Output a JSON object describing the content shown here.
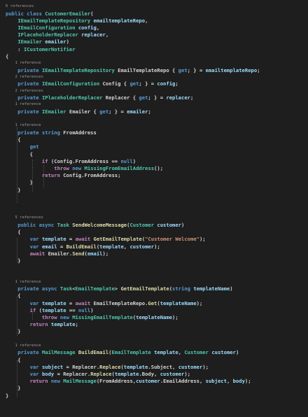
{
  "editor": {
    "theme": {
      "background": "#1e1e1e",
      "keyword": "#569cd6",
      "control": "#c586c0",
      "type": "#4ec9b0",
      "method": "#dcdcaa",
      "variable": "#9cdcfe",
      "string": "#ce9178",
      "text": "#d4d4d4",
      "lens": "#9a9a9a"
    },
    "lines": [
      {
        "kind": "lens",
        "text": "6 references"
      },
      {
        "kind": "code",
        "tokens": [
          [
            "kw",
            "public class "
          ],
          [
            "ty",
            "CustomerEmailer"
          ],
          [
            "pu",
            "("
          ]
        ]
      },
      {
        "kind": "code",
        "tokens": [
          [
            "pu",
            "    "
          ],
          [
            "ty",
            "IEmailTemplateRepository"
          ],
          [
            "pu",
            " "
          ],
          [
            "vr",
            "emailtemplateRepo"
          ],
          [
            "pu",
            ","
          ]
        ]
      },
      {
        "kind": "code",
        "tokens": [
          [
            "pu",
            "    "
          ],
          [
            "ty",
            "IEmailConfiguration"
          ],
          [
            "pu",
            " "
          ],
          [
            "vr",
            "config"
          ],
          [
            "pu",
            ","
          ]
        ]
      },
      {
        "kind": "code",
        "tokens": [
          [
            "pu",
            "    "
          ],
          [
            "ty",
            "IPlaceholderReplacer"
          ],
          [
            "pu",
            " "
          ],
          [
            "vr",
            "replacer"
          ],
          [
            "pu",
            ","
          ]
        ]
      },
      {
        "kind": "code",
        "tokens": [
          [
            "pu",
            "    "
          ],
          [
            "ty",
            "IEmailer"
          ],
          [
            "pu",
            " "
          ],
          [
            "vr",
            "emailer"
          ],
          [
            "pu",
            ")"
          ]
        ]
      },
      {
        "kind": "code",
        "tokens": [
          [
            "pu",
            "    : "
          ],
          [
            "ty",
            "ICustomerNotifier"
          ]
        ]
      },
      {
        "kind": "code",
        "tokens": [
          [
            "pu",
            "{"
          ]
        ]
      },
      {
        "kind": "lens",
        "text": "    1 reference"
      },
      {
        "kind": "code",
        "tokens": [
          [
            "kw",
            "    private "
          ],
          [
            "ty",
            "IEmailTemplateRepository"
          ],
          [
            "pu",
            " EmailTemplateRepo { "
          ],
          [
            "kw",
            "get"
          ],
          [
            "pu",
            "; } = "
          ],
          [
            "vr",
            "emailtemplateRepo"
          ],
          [
            "pu",
            ";"
          ]
        ]
      },
      {
        "kind": "lens",
        "text": "    2 references"
      },
      {
        "kind": "code",
        "tokens": [
          [
            "kw",
            "    private "
          ],
          [
            "ty",
            "IEmailConfiguration"
          ],
          [
            "pu",
            " Config { "
          ],
          [
            "kw",
            "get"
          ],
          [
            "pu",
            "; } = "
          ],
          [
            "vr",
            "config"
          ],
          [
            "pu",
            ";"
          ]
        ]
      },
      {
        "kind": "lens",
        "text": "    2 references"
      },
      {
        "kind": "code",
        "tokens": [
          [
            "kw",
            "    private "
          ],
          [
            "ty",
            "IPlaceholderReplacer"
          ],
          [
            "pu",
            " Replacer { "
          ],
          [
            "kw",
            "get"
          ],
          [
            "pu",
            "; } = "
          ],
          [
            "vr",
            "replacer"
          ],
          [
            "pu",
            ";"
          ]
        ]
      },
      {
        "kind": "lens",
        "text": "    1 reference"
      },
      {
        "kind": "code",
        "tokens": [
          [
            "kw",
            "    private "
          ],
          [
            "ty",
            "IEmailer"
          ],
          [
            "pu",
            " Emailer { "
          ],
          [
            "kw",
            "get"
          ],
          [
            "pu",
            "; } = "
          ],
          [
            "vr",
            "emailer"
          ],
          [
            "pu",
            ";"
          ]
        ]
      },
      {
        "kind": "blank"
      },
      {
        "kind": "lens",
        "text": "    1 reference"
      },
      {
        "kind": "code",
        "tokens": [
          [
            "kw",
            "    private string "
          ],
          [
            "pu",
            "FromAddress"
          ]
        ]
      },
      {
        "kind": "code",
        "tokens": [
          [
            "pu",
            "    {"
          ]
        ]
      },
      {
        "kind": "code",
        "tokens": [
          [
            "kw",
            "        get"
          ]
        ]
      },
      {
        "kind": "code",
        "tokens": [
          [
            "pu",
            "        {"
          ]
        ]
      },
      {
        "kind": "code",
        "tokens": [
          [
            "ctl",
            "            if "
          ],
          [
            "pu",
            "(Config.FromAddress == "
          ],
          [
            "kw",
            "null"
          ],
          [
            "pu",
            ")"
          ]
        ]
      },
      {
        "kind": "code",
        "tokens": [
          [
            "ctl",
            "                throw "
          ],
          [
            "kw",
            "new "
          ],
          [
            "ty",
            "MissingFromEmailAddress"
          ],
          [
            "pu",
            "();"
          ]
        ]
      },
      {
        "kind": "code",
        "tokens": [
          [
            "ctl",
            "            return "
          ],
          [
            "pu",
            "Config.FromAddress;"
          ]
        ]
      },
      {
        "kind": "code",
        "tokens": [
          [
            "pu",
            "        }"
          ]
        ]
      },
      {
        "kind": "code",
        "tokens": [
          [
            "pu",
            "    }"
          ]
        ]
      },
      {
        "kind": "blank"
      },
      {
        "kind": "blank"
      },
      {
        "kind": "blank"
      },
      {
        "kind": "lens",
        "text": "    5 references"
      },
      {
        "kind": "code",
        "tokens": [
          [
            "kw",
            "    public async "
          ],
          [
            "ty",
            "Task"
          ],
          [
            "pu",
            " "
          ],
          [
            "fn",
            "SendWelcomeMessage"
          ],
          [
            "pu",
            "("
          ],
          [
            "ty",
            "Customer"
          ],
          [
            "pu",
            " "
          ],
          [
            "vr",
            "customer"
          ],
          [
            "pu",
            ")"
          ]
        ]
      },
      {
        "kind": "code",
        "tokens": [
          [
            "pu",
            "    {"
          ]
        ]
      },
      {
        "kind": "code",
        "tokens": [
          [
            "kw",
            "        var "
          ],
          [
            "vr",
            "template"
          ],
          [
            "pu",
            " = "
          ],
          [
            "ctl",
            "await "
          ],
          [
            "fn",
            "GetEmailTemplate"
          ],
          [
            "pu",
            "("
          ],
          [
            "st",
            "\"Customer Welcome\""
          ],
          [
            "pu",
            ");"
          ]
        ]
      },
      {
        "kind": "code",
        "tokens": [
          [
            "kw",
            "        var "
          ],
          [
            "vr",
            "email"
          ],
          [
            "pu",
            " = "
          ],
          [
            "fn",
            "BuildEmail"
          ],
          [
            "pu",
            "("
          ],
          [
            "vr",
            "template"
          ],
          [
            "pu",
            ", "
          ],
          [
            "vr",
            "customer"
          ],
          [
            "pu",
            ");"
          ]
        ]
      },
      {
        "kind": "code",
        "tokens": [
          [
            "ctl",
            "        await "
          ],
          [
            "pu",
            "Emailer."
          ],
          [
            "fn",
            "Send"
          ],
          [
            "pu",
            "("
          ],
          [
            "vr",
            "email"
          ],
          [
            "pu",
            ");"
          ]
        ]
      },
      {
        "kind": "code",
        "tokens": [
          [
            "pu",
            "    }"
          ]
        ]
      },
      {
        "kind": "blank"
      },
      {
        "kind": "blank"
      },
      {
        "kind": "lens",
        "text": "    1 reference"
      },
      {
        "kind": "code",
        "tokens": [
          [
            "kw",
            "    private async "
          ],
          [
            "ty",
            "Task"
          ],
          [
            "pu",
            "<"
          ],
          [
            "ty",
            "EmailTemplate"
          ],
          [
            "pu",
            "> "
          ],
          [
            "fn",
            "GetEmailTemplate"
          ],
          [
            "pu",
            "("
          ],
          [
            "kw",
            "string "
          ],
          [
            "vr",
            "templateName"
          ],
          [
            "pu",
            ")"
          ]
        ]
      },
      {
        "kind": "code",
        "tokens": [
          [
            "pu",
            "    {"
          ]
        ]
      },
      {
        "kind": "code",
        "tokens": [
          [
            "kw",
            "        var "
          ],
          [
            "vr",
            "template"
          ],
          [
            "pu",
            " = "
          ],
          [
            "ctl",
            "await "
          ],
          [
            "pu",
            "EmailTemplateRepo."
          ],
          [
            "fn",
            "Get"
          ],
          [
            "pu",
            "("
          ],
          [
            "vr",
            "templateName"
          ],
          [
            "pu",
            ");"
          ]
        ]
      },
      {
        "kind": "code",
        "tokens": [
          [
            "ctl",
            "        if "
          ],
          [
            "pu",
            "("
          ],
          [
            "vr",
            "template"
          ],
          [
            "pu",
            " == "
          ],
          [
            "kw",
            "null"
          ],
          [
            "pu",
            ")"
          ]
        ]
      },
      {
        "kind": "code",
        "tokens": [
          [
            "ctl",
            "            throw "
          ],
          [
            "kw",
            "new "
          ],
          [
            "ty",
            "MissingEmailTemplate"
          ],
          [
            "pu",
            "("
          ],
          [
            "vr",
            "templateName"
          ],
          [
            "pu",
            ");"
          ]
        ]
      },
      {
        "kind": "code",
        "tokens": [
          [
            "ctl",
            "        return "
          ],
          [
            "vr",
            "template"
          ],
          [
            "pu",
            ";"
          ]
        ]
      },
      {
        "kind": "code",
        "tokens": [
          [
            "pu",
            "    }"
          ]
        ]
      },
      {
        "kind": "blank"
      },
      {
        "kind": "lens",
        "text": "    1 reference"
      },
      {
        "kind": "code",
        "tokens": [
          [
            "kw",
            "    private "
          ],
          [
            "ty",
            "MailMessage"
          ],
          [
            "pu",
            " "
          ],
          [
            "fn",
            "BuildEmail"
          ],
          [
            "pu",
            "("
          ],
          [
            "ty",
            "EmailTemplate"
          ],
          [
            "pu",
            " "
          ],
          [
            "vr",
            "template"
          ],
          [
            "pu",
            ", "
          ],
          [
            "ty",
            "Customer"
          ],
          [
            "pu",
            " "
          ],
          [
            "vr",
            "customer"
          ],
          [
            "pu",
            ")"
          ]
        ]
      },
      {
        "kind": "code",
        "tokens": [
          [
            "pu",
            "    {"
          ]
        ]
      },
      {
        "kind": "code",
        "tokens": [
          [
            "kw",
            "        var "
          ],
          [
            "vr",
            "subject"
          ],
          [
            "pu",
            " = Replacer."
          ],
          [
            "fn",
            "Replace"
          ],
          [
            "pu",
            "("
          ],
          [
            "vr",
            "template"
          ],
          [
            "pu",
            ".Subject, "
          ],
          [
            "vr",
            "customer"
          ],
          [
            "pu",
            ");"
          ]
        ]
      },
      {
        "kind": "code",
        "tokens": [
          [
            "kw",
            "        var "
          ],
          [
            "vr",
            "body"
          ],
          [
            "pu",
            " = Replacer."
          ],
          [
            "fn",
            "Replace"
          ],
          [
            "pu",
            "("
          ],
          [
            "vr",
            "template"
          ],
          [
            "pu",
            ".Body, "
          ],
          [
            "vr",
            "customer"
          ],
          [
            "pu",
            ");"
          ]
        ]
      },
      {
        "kind": "code",
        "tokens": [
          [
            "ctl",
            "        return "
          ],
          [
            "kw",
            "new "
          ],
          [
            "ty",
            "MailMessage"
          ],
          [
            "pu",
            "(FromAddress,"
          ],
          [
            "vr",
            "customer"
          ],
          [
            "pu",
            ".EmailAddress, "
          ],
          [
            "vr",
            "subject"
          ],
          [
            "pu",
            ", "
          ],
          [
            "vr",
            "body"
          ],
          [
            "pu",
            ");"
          ]
        ]
      },
      {
        "kind": "code",
        "tokens": [
          [
            "pu",
            "    }"
          ]
        ]
      },
      {
        "kind": "code",
        "tokens": [
          [
            "pu",
            "}"
          ]
        ]
      }
    ]
  }
}
